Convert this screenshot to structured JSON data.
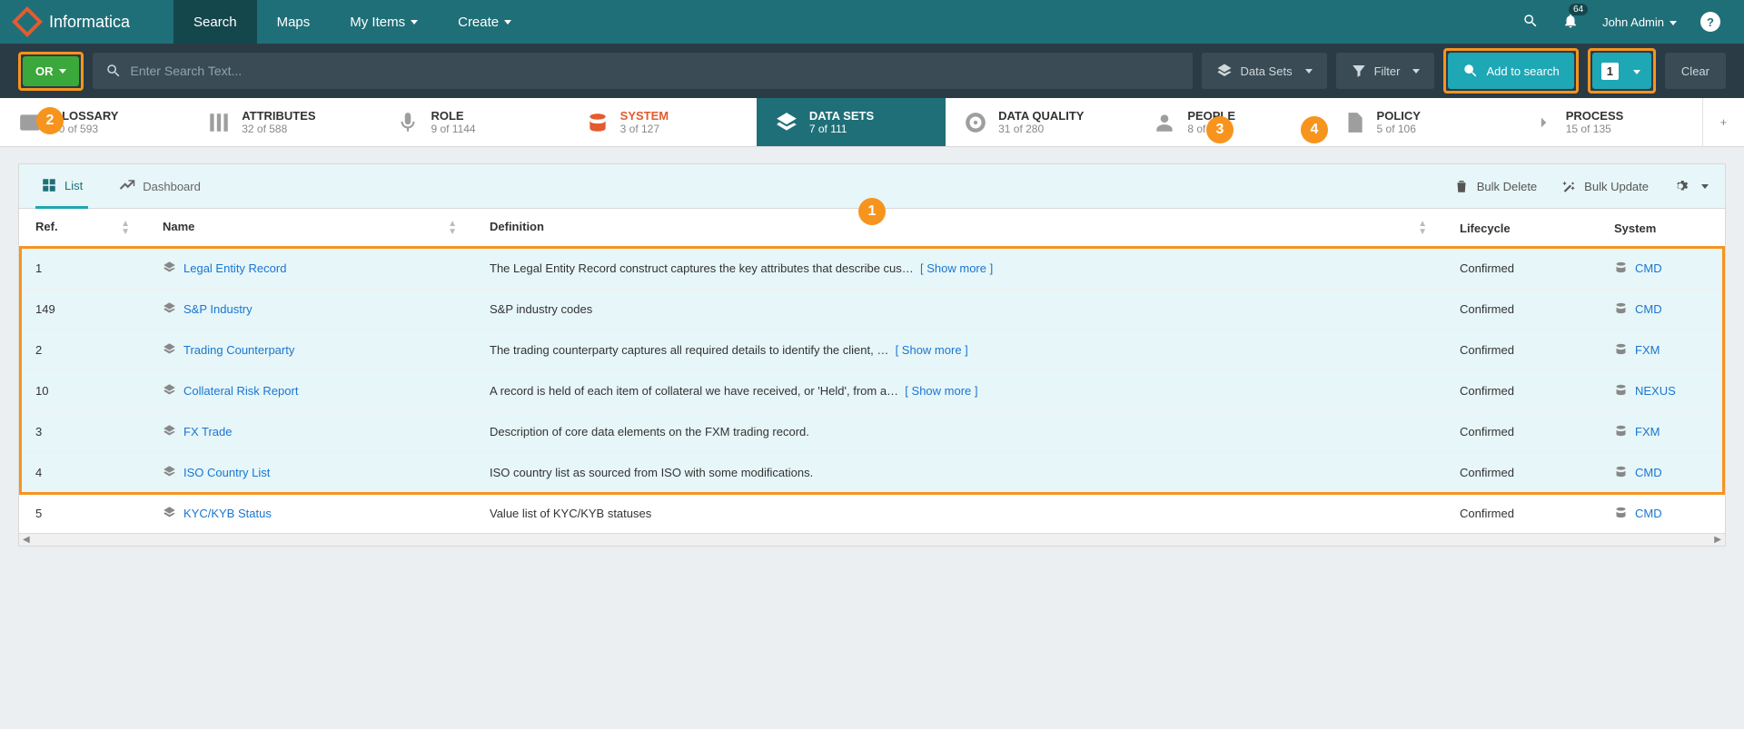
{
  "brand": "Informatica",
  "nav": {
    "search": "Search",
    "maps": "Maps",
    "myitems": "My Items",
    "create": "Create"
  },
  "topbar": {
    "notif_count": "64",
    "user": "John Admin"
  },
  "searchbar": {
    "bool": "OR",
    "placeholder": "Enter Search Text...",
    "datasets": "Data Sets",
    "filter": "Filter",
    "add": "Add to search",
    "count": "1",
    "clear": "Clear"
  },
  "categories": [
    {
      "label": "GLOSSARY",
      "sub": "30 of 593"
    },
    {
      "label": "ATTRIBUTES",
      "sub": "32 of 588"
    },
    {
      "label": "ROLE",
      "sub": "9 of 1144"
    },
    {
      "label": "SYSTEM",
      "sub": "3 of 127"
    },
    {
      "label": "DATA SETS",
      "sub": "7 of 111"
    },
    {
      "label": "DATA QUALITY",
      "sub": "31 of 280"
    },
    {
      "label": "PEOPLE",
      "sub": "8 of 472"
    },
    {
      "label": "POLICY",
      "sub": "5 of 106"
    },
    {
      "label": "PROCESS",
      "sub": "15 of 135"
    }
  ],
  "views": {
    "list": "List",
    "dashboard": "Dashboard"
  },
  "actions": {
    "bulkdelete": "Bulk Delete",
    "bulkupdate": "Bulk Update"
  },
  "columns": {
    "ref": "Ref.",
    "name": "Name",
    "def": "Definition",
    "life": "Lifecycle",
    "sys": "System"
  },
  "showmore": "[ Show more ]",
  "rows": [
    {
      "ref": "1",
      "name": "Legal Entity Record",
      "def": "The Legal Entity Record construct captures the key attributes that describe cus…",
      "more": true,
      "life": "Confirmed",
      "sys": "CMD",
      "sel": true
    },
    {
      "ref": "149",
      "name": "S&P Industry",
      "def": "S&P industry codes",
      "more": false,
      "life": "Confirmed",
      "sys": "CMD",
      "sel": true
    },
    {
      "ref": "2",
      "name": "Trading Counterparty",
      "def": "The trading counterparty captures all required details to identify the client, …",
      "more": true,
      "life": "Confirmed",
      "sys": "FXM",
      "sel": true
    },
    {
      "ref": "10",
      "name": "Collateral Risk Report",
      "def": "A record is held of each item of collateral we have received, or 'Held', from a…",
      "more": true,
      "life": "Confirmed",
      "sys": "NEXUS",
      "sel": true
    },
    {
      "ref": "3",
      "name": "FX Trade",
      "def": "Description of core data elements on the FXM trading record.",
      "more": false,
      "life": "Confirmed",
      "sys": "FXM",
      "sel": true
    },
    {
      "ref": "4",
      "name": "ISO Country List",
      "def": "ISO country list as sourced from ISO with some modifications.",
      "more": false,
      "life": "Confirmed",
      "sys": "CMD",
      "sel": true
    },
    {
      "ref": "5",
      "name": "KYC/KYB Status",
      "def": "Value list of KYC/KYB statuses",
      "more": false,
      "life": "Confirmed",
      "sys": "CMD",
      "sel": false
    }
  ],
  "annotations": {
    "a1": "1",
    "a2": "2",
    "a3": "3",
    "a4": "4"
  }
}
